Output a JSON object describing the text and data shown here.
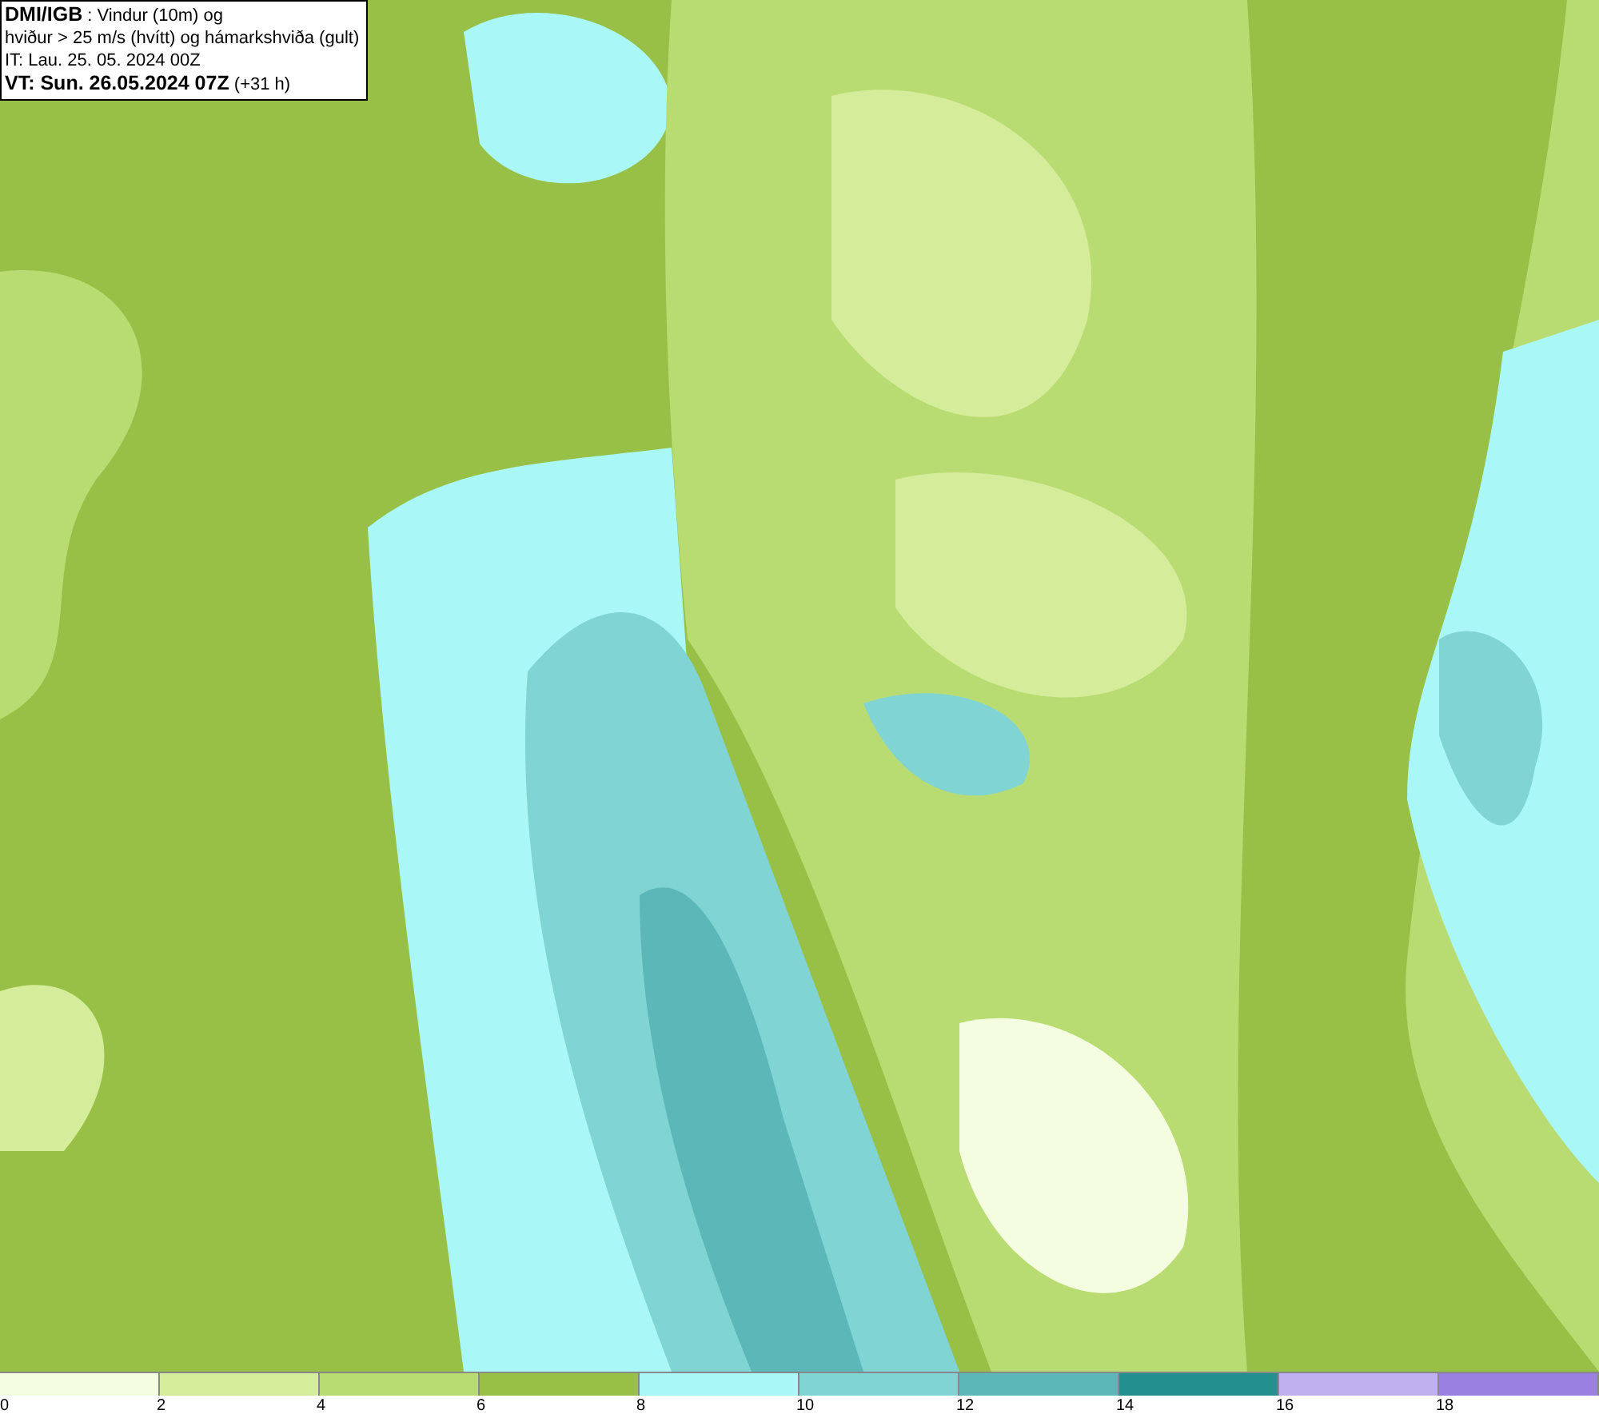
{
  "header": {
    "lines": [
      "**DMI/IGB** : Vindur (10m) og",
      "hviður > 25 m/s (hvítt) og hámarkshviða (gult)",
      "IT: Lau. 25. 05. 2024 00Z",
      "**VT: Sun. 26.05.2024 07Z** (+31 h)"
    ]
  },
  "legend": {
    "bins": [
      {
        "color": "#f5fde0",
        "label": "0"
      },
      {
        "color": "#d5ec9a",
        "label": "2"
      },
      {
        "color": "#b9dc72",
        "label": "4"
      },
      {
        "color": "#98c046",
        "label": "6"
      },
      {
        "color": "#aaf7f7",
        "label": "8"
      },
      {
        "color": "#80d4d4",
        "label": "10"
      },
      {
        "color": "#5cb8b8",
        "label": "12"
      },
      {
        "color": "#238f8f",
        "label": "14"
      },
      {
        "color": "#c0b0f0",
        "label": "16"
      },
      {
        "color": "#9a80e0",
        "label": "18"
      }
    ]
  }
}
